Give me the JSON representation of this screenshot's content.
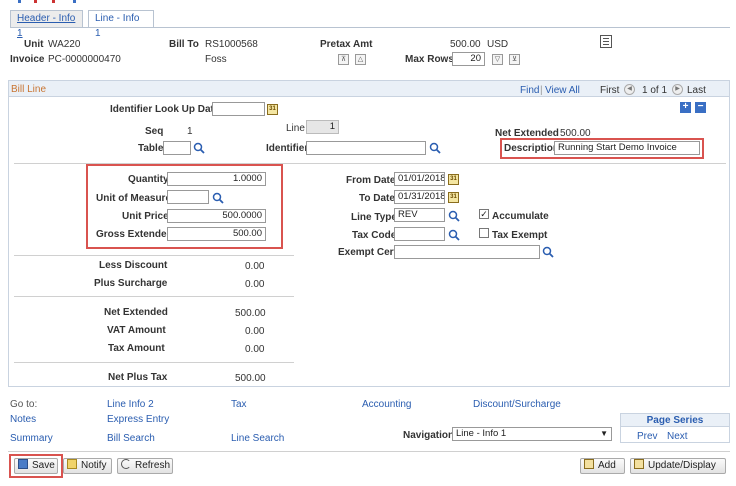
{
  "tabs": [
    {
      "label": "Header - Info 1"
    },
    {
      "label": "Line - Info 1"
    }
  ],
  "header": {
    "unit_label": "Unit",
    "unit_value": "WA220",
    "bill_to_label": "Bill To",
    "bill_to_value": "RS1000568",
    "bill_to_name": "Foss",
    "pretax_label": "Pretax Amt",
    "pretax_value": "500.00",
    "currency": "USD",
    "invoice_label": "Invoice",
    "invoice_value": "PC-0000000470",
    "max_rows_label": "Max Rows",
    "max_rows_value": "20"
  },
  "bill_line": {
    "title": "Bill Line",
    "find_label": "Find",
    "view_all_label": "View All",
    "sep": "|",
    "first_label": "First",
    "page_info": "1 of 1",
    "last_label": "Last",
    "identifier_lookup_label": "Identifier Look Up Date",
    "identifier_lookup_value": "",
    "seq_label": "Seq",
    "seq_value": "1",
    "line_label": "Line",
    "line_value": "1",
    "net_extended_top_label": "Net Extended",
    "net_extended_top_value": "500.00",
    "table_label": "Table",
    "table_value": "",
    "identifier_label": "Identifier",
    "identifier_value": "",
    "description_label": "Description",
    "description_value": "Running Start Demo Invoice",
    "quantity_label": "Quantity",
    "quantity_value": "1.0000",
    "uom_label": "Unit of Measure",
    "uom_value": "",
    "unit_price_label": "Unit Price",
    "unit_price_value": "500.0000",
    "gross_extended_label": "Gross Extended",
    "gross_extended_value": "500.00",
    "from_date_label": "From Date",
    "from_date_value": "01/01/2018",
    "to_date_label": "To Date",
    "to_date_value": "01/31/2018",
    "line_type_label": "Line Type",
    "line_type_value": "REV",
    "accumulate_label": "Accumulate",
    "tax_code_label": "Tax Code",
    "tax_code_value": "",
    "tax_exempt_label": "Tax Exempt",
    "exempt_cert_label": "Exempt Cert",
    "exempt_cert_value": "",
    "less_discount_label": "Less Discount",
    "less_discount_value": "0.00",
    "plus_surcharge_label": "Plus Surcharge",
    "plus_surcharge_value": "0.00",
    "net_extended_label": "Net Extended",
    "net_extended_value": "500.00",
    "vat_amount_label": "VAT Amount",
    "vat_amount_value": "0.00",
    "tax_amount_label": "Tax Amount",
    "tax_amount_value": "0.00",
    "net_plus_tax_label": "Net Plus Tax",
    "net_plus_tax_value": "500.00"
  },
  "goto": {
    "goto_label": "Go to:",
    "line_info_2": "Line Info 2",
    "tax": "Tax",
    "accounting": "Accounting",
    "discount_surcharge": "Discount/Surcharge",
    "notes": "Notes",
    "express_entry": "Express Entry",
    "summary": "Summary",
    "bill_search": "Bill Search",
    "line_search": "Line Search",
    "navigation_label": "Navigation",
    "navigation_value": "Line - Info 1",
    "page_series_label": "Page Series",
    "prev_label": "Prev",
    "next_label": "Next"
  },
  "toolbar": {
    "save_label": "Save",
    "notify_label": "Notify",
    "refresh_label": "Refresh",
    "add_label": "Add",
    "update_display_label": "Update/Display"
  },
  "colors": {
    "highlight_border": "#d9534f",
    "link": "#2a5db0",
    "section_title": "#c87533"
  }
}
